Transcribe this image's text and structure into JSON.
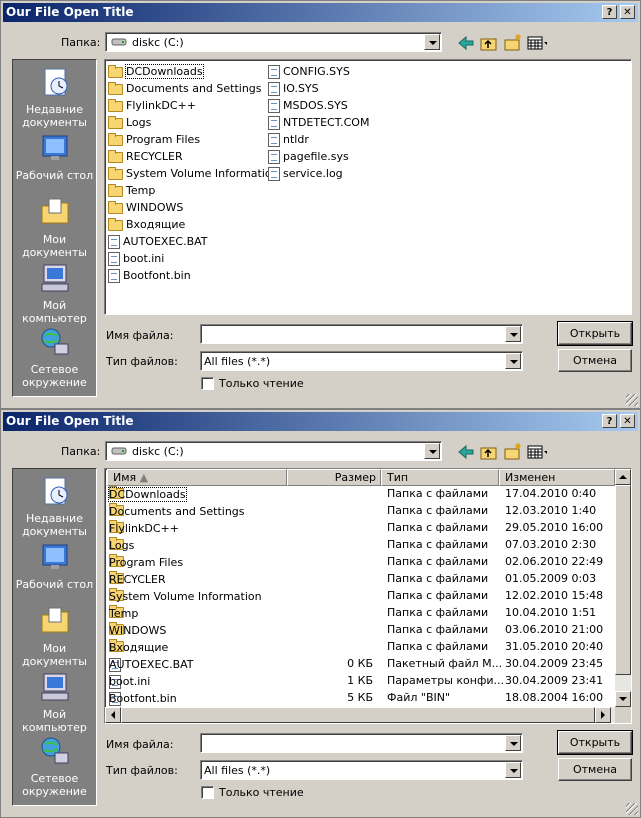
{
  "dialog1": {
    "title": "Our File Open Title",
    "help": "?",
    "close": "✕",
    "lookin_label": "Папка:",
    "lookin_value": "diskc (C:)",
    "places": [
      {
        "label": "Недавние документы"
      },
      {
        "label": "Рабочий стол"
      },
      {
        "label": "Мои документы"
      },
      {
        "label": "Мой компьютер"
      },
      {
        "label": "Сетевое окружение"
      }
    ],
    "files_col1": [
      {
        "name": "DCDownloads",
        "kind": "folder"
      },
      {
        "name": "Documents and Settings",
        "kind": "folder"
      },
      {
        "name": "FlylinkDC++",
        "kind": "folder"
      },
      {
        "name": "Logs",
        "kind": "folder"
      },
      {
        "name": "Program Files",
        "kind": "folder"
      },
      {
        "name": "RECYCLER",
        "kind": "folder"
      },
      {
        "name": "System Volume Information",
        "kind": "folder"
      },
      {
        "name": "Temp",
        "kind": "folder"
      },
      {
        "name": "WINDOWS",
        "kind": "folder"
      },
      {
        "name": "Входящие",
        "kind": "folder"
      },
      {
        "name": "AUTOEXEC.BAT",
        "kind": "file"
      },
      {
        "name": "boot.ini",
        "kind": "file"
      },
      {
        "name": "Bootfont.bin",
        "kind": "file"
      }
    ],
    "files_col2": [
      {
        "name": "CONFIG.SYS",
        "kind": "file"
      },
      {
        "name": "IO.SYS",
        "kind": "file"
      },
      {
        "name": "MSDOS.SYS",
        "kind": "file"
      },
      {
        "name": "NTDETECT.COM",
        "kind": "file"
      },
      {
        "name": "ntldr",
        "kind": "file"
      },
      {
        "name": "pagefile.sys",
        "kind": "file"
      },
      {
        "name": "service.log",
        "kind": "file"
      }
    ],
    "filename_label": "Имя файла:",
    "filename_value": "",
    "filetype_label": "Тип файлов:",
    "filetype_value": "All files (*.*)",
    "open_button": "Открыть",
    "cancel_button": "Отмена",
    "readonly_label": "Только чтение"
  },
  "dialog2": {
    "title": "Our File Open Title",
    "help": "?",
    "close": "✕",
    "lookin_label": "Папка:",
    "lookin_value": "diskc (C:)",
    "places": [
      {
        "label": "Недавние документы"
      },
      {
        "label": "Рабочий стол"
      },
      {
        "label": "Мои документы"
      },
      {
        "label": "Мой компьютер"
      },
      {
        "label": "Сетевое окружение"
      }
    ],
    "columns": {
      "name": "Имя",
      "size": "Размер",
      "type": "Тип",
      "modified": "Изменен"
    },
    "rows": [
      {
        "name": "DCDownloads",
        "size": "",
        "type": "Папка с файлами",
        "modified": "17.04.2010 0:40",
        "kind": "folder"
      },
      {
        "name": "Documents and Settings",
        "size": "",
        "type": "Папка с файлами",
        "modified": "12.03.2010 1:40",
        "kind": "folder"
      },
      {
        "name": "FlylinkDC++",
        "size": "",
        "type": "Папка с файлами",
        "modified": "29.05.2010 16:00",
        "kind": "folder"
      },
      {
        "name": "Logs",
        "size": "",
        "type": "Папка с файлами",
        "modified": "07.03.2010 2:30",
        "kind": "folder"
      },
      {
        "name": "Program Files",
        "size": "",
        "type": "Папка с файлами",
        "modified": "02.06.2010 22:49",
        "kind": "folder"
      },
      {
        "name": "RECYCLER",
        "size": "",
        "type": "Папка с файлами",
        "modified": "01.05.2009 0:03",
        "kind": "folder"
      },
      {
        "name": "System Volume Information",
        "size": "",
        "type": "Папка с файлами",
        "modified": "12.02.2010 15:48",
        "kind": "folder"
      },
      {
        "name": "Temp",
        "size": "",
        "type": "Папка с файлами",
        "modified": "10.04.2010 1:51",
        "kind": "folder"
      },
      {
        "name": "WINDOWS",
        "size": "",
        "type": "Папка с файлами",
        "modified": "03.06.2010 21:00",
        "kind": "folder"
      },
      {
        "name": "Входящие",
        "size": "",
        "type": "Папка с файлами",
        "modified": "31.05.2010 20:40",
        "kind": "folder"
      },
      {
        "name": "AUTOEXEC.BAT",
        "size": "0 КБ",
        "type": "Пакетный файл М...",
        "modified": "30.04.2009 23:45",
        "kind": "file"
      },
      {
        "name": "boot.ini",
        "size": "1 КБ",
        "type": "Параметры конфи...",
        "modified": "30.04.2009 23:41",
        "kind": "file"
      },
      {
        "name": "Bootfont.bin",
        "size": "5 КБ",
        "type": "Файл \"BIN\"",
        "modified": "18.08.2004 16:00",
        "kind": "file"
      }
    ],
    "filename_label": "Имя файла:",
    "filename_value": "",
    "filetype_label": "Тип файлов:",
    "filetype_value": "All files (*.*)",
    "open_button": "Открыть",
    "cancel_button": "Отмена",
    "readonly_label": "Только чтение"
  },
  "colors": {
    "titlebar_start": "#0a246a",
    "titlebar_end": "#a6caf0",
    "face": "#d4d0c8",
    "places_bg": "#808080"
  },
  "icons": [
    "back-arrow-icon",
    "up-folder-icon",
    "new-folder-icon",
    "view-menu-icon",
    "drive-icon",
    "folder-icon",
    "file-icon"
  ]
}
